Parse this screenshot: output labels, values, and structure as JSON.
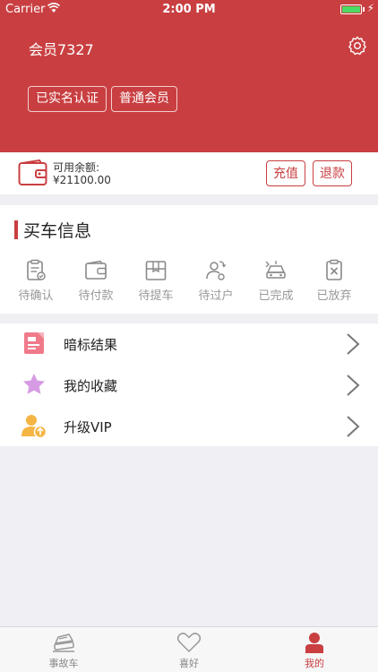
{
  "status_bar": {
    "carrier": "Carrier",
    "time": "2:00 PM"
  },
  "header": {
    "member_name": "会员7327",
    "tags": [
      "已实名认证",
      "普通会员"
    ]
  },
  "balance": {
    "label": "可用余额:",
    "value": "¥21100.00",
    "recharge_label": "充值",
    "refund_label": "退款"
  },
  "buy_info": {
    "title": "买车信息",
    "statuses": [
      {
        "label": "待确认",
        "icon": "clipboard-check-icon"
      },
      {
        "label": "待付款",
        "icon": "wallet-icon"
      },
      {
        "label": "待提车",
        "icon": "box-icon"
      },
      {
        "label": "待过户",
        "icon": "users-transfer-icon"
      },
      {
        "label": "已完成",
        "icon": "car-done-icon"
      },
      {
        "label": "已放弃",
        "icon": "clipboard-x-icon"
      }
    ]
  },
  "menu": {
    "items": [
      {
        "label": "暗标结果",
        "icon": "document-icon",
        "color": "#f07a8a"
      },
      {
        "label": "我的收藏",
        "icon": "star-icon",
        "color": "#d79be4"
      },
      {
        "label": "升级VIP",
        "icon": "user-upgrade-icon",
        "color": "#f5b544"
      }
    ]
  },
  "tabbar": {
    "tabs": [
      {
        "label": "事故车",
        "icon": "car-crash-icon"
      },
      {
        "label": "喜好",
        "icon": "heart-icon"
      },
      {
        "label": "我的",
        "icon": "person-icon",
        "active": true
      }
    ]
  },
  "colors": {
    "brand": "#c93f41",
    "background": "#efeff4"
  }
}
